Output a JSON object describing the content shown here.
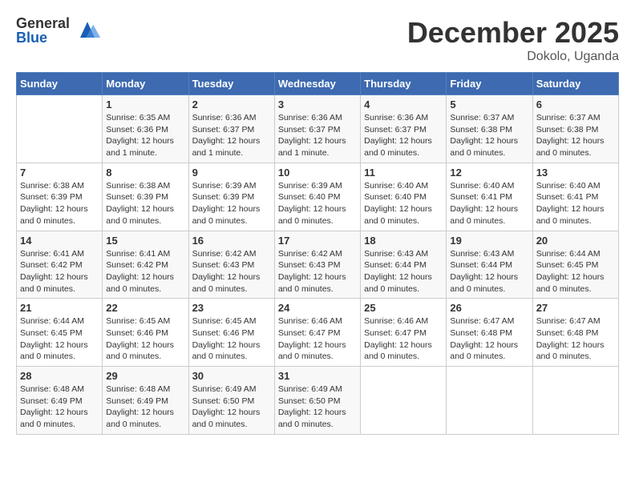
{
  "logo": {
    "general": "General",
    "blue": "Blue"
  },
  "title": "December 2025",
  "location": "Dokolo, Uganda",
  "days_header": [
    "Sunday",
    "Monday",
    "Tuesday",
    "Wednesday",
    "Thursday",
    "Friday",
    "Saturday"
  ],
  "weeks": [
    [
      {
        "day": "",
        "info": ""
      },
      {
        "day": "1",
        "info": "Sunrise: 6:35 AM\nSunset: 6:36 PM\nDaylight: 12 hours\nand 1 minute."
      },
      {
        "day": "2",
        "info": "Sunrise: 6:36 AM\nSunset: 6:37 PM\nDaylight: 12 hours\nand 1 minute."
      },
      {
        "day": "3",
        "info": "Sunrise: 6:36 AM\nSunset: 6:37 PM\nDaylight: 12 hours\nand 1 minute."
      },
      {
        "day": "4",
        "info": "Sunrise: 6:36 AM\nSunset: 6:37 PM\nDaylight: 12 hours\nand 0 minutes."
      },
      {
        "day": "5",
        "info": "Sunrise: 6:37 AM\nSunset: 6:38 PM\nDaylight: 12 hours\nand 0 minutes."
      },
      {
        "day": "6",
        "info": "Sunrise: 6:37 AM\nSunset: 6:38 PM\nDaylight: 12 hours\nand 0 minutes."
      }
    ],
    [
      {
        "day": "7",
        "info": "Sunrise: 6:38 AM\nSunset: 6:39 PM\nDaylight: 12 hours\nand 0 minutes."
      },
      {
        "day": "8",
        "info": "Sunrise: 6:38 AM\nSunset: 6:39 PM\nDaylight: 12 hours\nand 0 minutes."
      },
      {
        "day": "9",
        "info": "Sunrise: 6:39 AM\nSunset: 6:39 PM\nDaylight: 12 hours\nand 0 minutes."
      },
      {
        "day": "10",
        "info": "Sunrise: 6:39 AM\nSunset: 6:40 PM\nDaylight: 12 hours\nand 0 minutes."
      },
      {
        "day": "11",
        "info": "Sunrise: 6:40 AM\nSunset: 6:40 PM\nDaylight: 12 hours\nand 0 minutes."
      },
      {
        "day": "12",
        "info": "Sunrise: 6:40 AM\nSunset: 6:41 PM\nDaylight: 12 hours\nand 0 minutes."
      },
      {
        "day": "13",
        "info": "Sunrise: 6:40 AM\nSunset: 6:41 PM\nDaylight: 12 hours\nand 0 minutes."
      }
    ],
    [
      {
        "day": "14",
        "info": "Sunrise: 6:41 AM\nSunset: 6:42 PM\nDaylight: 12 hours\nand 0 minutes."
      },
      {
        "day": "15",
        "info": "Sunrise: 6:41 AM\nSunset: 6:42 PM\nDaylight: 12 hours\nand 0 minutes."
      },
      {
        "day": "16",
        "info": "Sunrise: 6:42 AM\nSunset: 6:43 PM\nDaylight: 12 hours\nand 0 minutes."
      },
      {
        "day": "17",
        "info": "Sunrise: 6:42 AM\nSunset: 6:43 PM\nDaylight: 12 hours\nand 0 minutes."
      },
      {
        "day": "18",
        "info": "Sunrise: 6:43 AM\nSunset: 6:44 PM\nDaylight: 12 hours\nand 0 minutes."
      },
      {
        "day": "19",
        "info": "Sunrise: 6:43 AM\nSunset: 6:44 PM\nDaylight: 12 hours\nand 0 minutes."
      },
      {
        "day": "20",
        "info": "Sunrise: 6:44 AM\nSunset: 6:45 PM\nDaylight: 12 hours\nand 0 minutes."
      }
    ],
    [
      {
        "day": "21",
        "info": "Sunrise: 6:44 AM\nSunset: 6:45 PM\nDaylight: 12 hours\nand 0 minutes."
      },
      {
        "day": "22",
        "info": "Sunrise: 6:45 AM\nSunset: 6:46 PM\nDaylight: 12 hours\nand 0 minutes."
      },
      {
        "day": "23",
        "info": "Sunrise: 6:45 AM\nSunset: 6:46 PM\nDaylight: 12 hours\nand 0 minutes."
      },
      {
        "day": "24",
        "info": "Sunrise: 6:46 AM\nSunset: 6:47 PM\nDaylight: 12 hours\nand 0 minutes."
      },
      {
        "day": "25",
        "info": "Sunrise: 6:46 AM\nSunset: 6:47 PM\nDaylight: 12 hours\nand 0 minutes."
      },
      {
        "day": "26",
        "info": "Sunrise: 6:47 AM\nSunset: 6:48 PM\nDaylight: 12 hours\nand 0 minutes."
      },
      {
        "day": "27",
        "info": "Sunrise: 6:47 AM\nSunset: 6:48 PM\nDaylight: 12 hours\nand 0 minutes."
      }
    ],
    [
      {
        "day": "28",
        "info": "Sunrise: 6:48 AM\nSunset: 6:49 PM\nDaylight: 12 hours\nand 0 minutes."
      },
      {
        "day": "29",
        "info": "Sunrise: 6:48 AM\nSunset: 6:49 PM\nDaylight: 12 hours\nand 0 minutes."
      },
      {
        "day": "30",
        "info": "Sunrise: 6:49 AM\nSunset: 6:50 PM\nDaylight: 12 hours\nand 0 minutes."
      },
      {
        "day": "31",
        "info": "Sunrise: 6:49 AM\nSunset: 6:50 PM\nDaylight: 12 hours\nand 0 minutes."
      },
      {
        "day": "",
        "info": ""
      },
      {
        "day": "",
        "info": ""
      },
      {
        "day": "",
        "info": ""
      }
    ]
  ]
}
